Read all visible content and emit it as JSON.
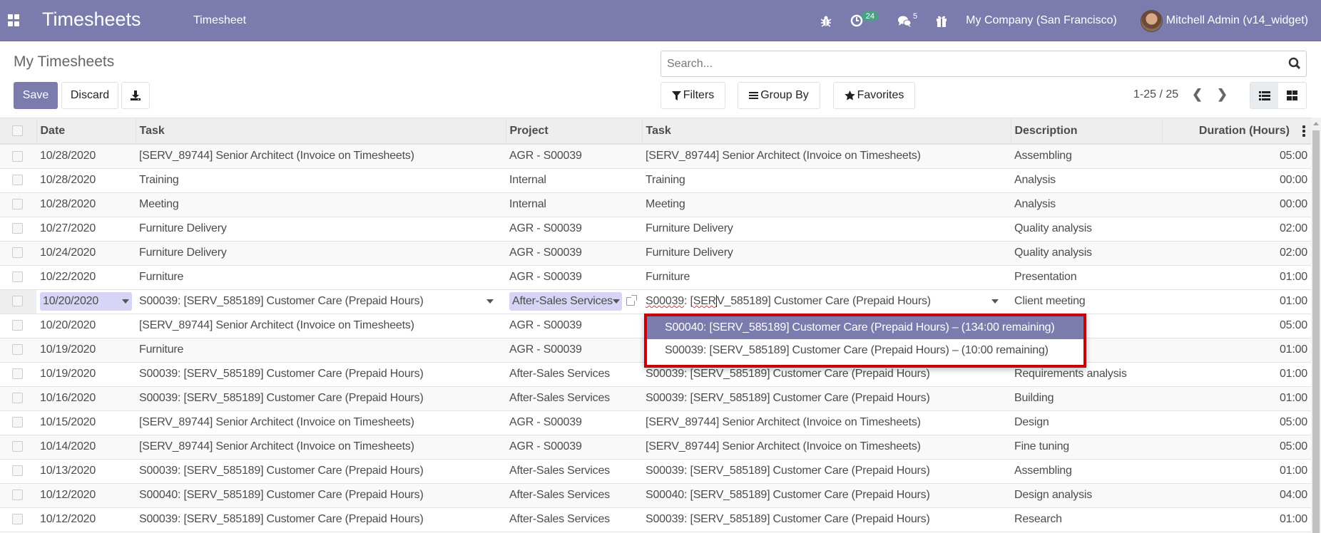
{
  "navbar": {
    "app_title": "Timesheets",
    "menu_item": "Timesheet",
    "activity_count": "24",
    "messages_count": "5",
    "company": "My Company (San Francisco)",
    "user": "Mitchell Admin (v14_widget)",
    "colors": {
      "brand": "#7c7bad",
      "badge": "#4a9f86"
    }
  },
  "control_panel": {
    "page_title": "My Timesheets",
    "save_label": "Save",
    "discard_label": "Discard",
    "search_placeholder": "Search...",
    "filters_label": "Filters",
    "group_by_label": "Group By",
    "favorites_label": "Favorites",
    "pager": "1-25 / 25"
  },
  "table": {
    "columns": [
      "Date",
      "Task",
      "Project",
      "Task",
      "Description",
      "Duration (Hours)"
    ],
    "rows": [
      {
        "date": "10/28/2020",
        "task": "[SERV_89744] Senior Architect (Invoice on Timesheets)",
        "project": "AGR - S00039",
        "task2": "[SERV_89744] Senior Architect (Invoice on Timesheets)",
        "description": "Assembling",
        "duration": "05:00"
      },
      {
        "date": "10/28/2020",
        "task": "Training",
        "project": "Internal",
        "task2": "Training",
        "description": "Analysis",
        "duration": "00:00"
      },
      {
        "date": "10/28/2020",
        "task": "Meeting",
        "project": "Internal",
        "task2": "Meeting",
        "description": "Analysis",
        "duration": "00:00"
      },
      {
        "date": "10/27/2020",
        "task": "Furniture Delivery",
        "project": "AGR - S00039",
        "task2": "Furniture Delivery",
        "description": "Quality analysis",
        "duration": "02:00"
      },
      {
        "date": "10/24/2020",
        "task": "Furniture Delivery",
        "project": "AGR - S00039",
        "task2": "Furniture Delivery",
        "description": "Quality analysis",
        "duration": "02:00"
      },
      {
        "date": "10/22/2020",
        "task": "Furniture",
        "project": "AGR - S00039",
        "task2": "Furniture",
        "description": "Presentation",
        "duration": "01:00"
      },
      {
        "date": "10/20/2020",
        "task": "S00039: [SERV_585189] Customer Care (Prepaid Hours)",
        "project": "After-Sales Services",
        "task2": "S00039: [SERV_585189] Customer Care (Prepaid Hours)",
        "description": "Client meeting",
        "duration": "01:00",
        "editing": true
      },
      {
        "date": "10/20/2020",
        "task": "[SERV_89744] Senior Architect (Invoice on Timesheets)",
        "project": "AGR - S00039",
        "task2": "",
        "description": "",
        "duration": "05:00"
      },
      {
        "date": "10/19/2020",
        "task": "Furniture",
        "project": "AGR - S00039",
        "task2": "",
        "description": "",
        "duration": "01:00"
      },
      {
        "date": "10/19/2020",
        "task": "S00039: [SERV_585189] Customer Care (Prepaid Hours)",
        "project": "After-Sales Services",
        "task2": "S00039: [SERV_585189] Customer Care (Prepaid Hours)",
        "description": "Requirements analysis",
        "duration": "01:00"
      },
      {
        "date": "10/16/2020",
        "task": "S00039: [SERV_585189] Customer Care (Prepaid Hours)",
        "project": "After-Sales Services",
        "task2": "S00039: [SERV_585189] Customer Care (Prepaid Hours)",
        "description": "Building",
        "duration": "01:00"
      },
      {
        "date": "10/15/2020",
        "task": "[SERV_89744] Senior Architect (Invoice on Timesheets)",
        "project": "AGR - S00039",
        "task2": "[SERV_89744] Senior Architect (Invoice on Timesheets)",
        "description": "Design",
        "duration": "05:00"
      },
      {
        "date": "10/14/2020",
        "task": "[SERV_89744] Senior Architect (Invoice on Timesheets)",
        "project": "AGR - S00039",
        "task2": "[SERV_89744] Senior Architect (Invoice on Timesheets)",
        "description": "Fine tuning",
        "duration": "05:00"
      },
      {
        "date": "10/13/2020",
        "task": "S00039: [SERV_585189] Customer Care (Prepaid Hours)",
        "project": "After-Sales Services",
        "task2": "S00039: [SERV_585189] Customer Care (Prepaid Hours)",
        "description": "Assembling",
        "duration": "01:00"
      },
      {
        "date": "10/12/2020",
        "task": "S00040: [SERV_585189] Customer Care (Prepaid Hours)",
        "project": "After-Sales Services",
        "task2": "S00040: [SERV_585189] Customer Care (Prepaid Hours)",
        "description": "Design analysis",
        "duration": "04:00"
      },
      {
        "date": "10/12/2020",
        "task": "S00039: [SERV_585189] Customer Care (Prepaid Hours)",
        "project": "After-Sales Services",
        "task2": "S00039: [SERV_585189] Customer Care (Prepaid Hours)",
        "description": "Research",
        "duration": "01:00"
      }
    ]
  },
  "edit_row": {
    "task2_prefix": "S00039",
    "task2_mid": ": [",
    "task2_spell": "SER",
    "task2_rest": "V_585189] Customer Care (Prepaid Hours)"
  },
  "dropdown": {
    "options": [
      "S00040: [SERV_585189] Customer Care (Prepaid Hours) – (134:00 remaining)",
      "S00039: [SERV_585189] Customer Care (Prepaid Hours) – (10:00 remaining)"
    ],
    "active_index": 0,
    "highlight_color": "#c4000a"
  }
}
